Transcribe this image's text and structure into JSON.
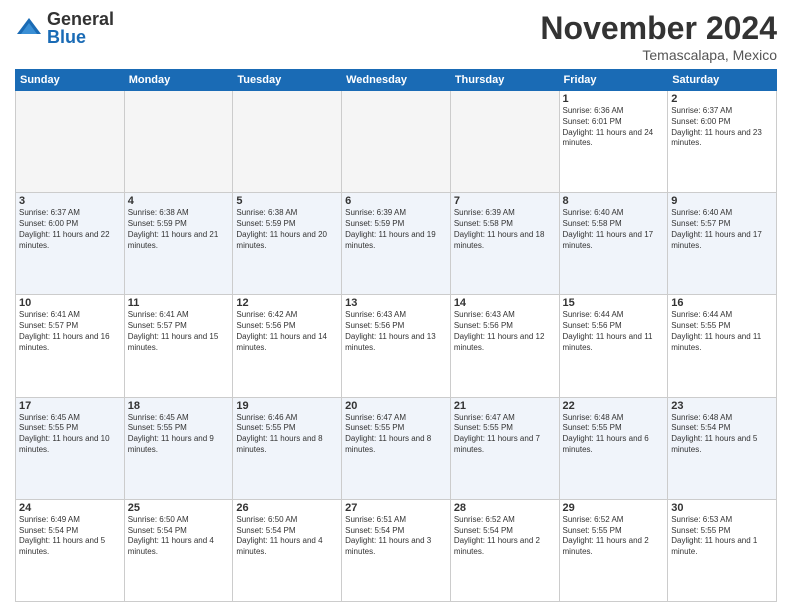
{
  "header": {
    "logo_general": "General",
    "logo_blue": "Blue",
    "month_title": "November 2024",
    "location": "Temascalapa, Mexico"
  },
  "columns": [
    "Sunday",
    "Monday",
    "Tuesday",
    "Wednesday",
    "Thursday",
    "Friday",
    "Saturday"
  ],
  "weeks": [
    [
      {
        "day": "",
        "info": ""
      },
      {
        "day": "",
        "info": ""
      },
      {
        "day": "",
        "info": ""
      },
      {
        "day": "",
        "info": ""
      },
      {
        "day": "",
        "info": ""
      },
      {
        "day": "1",
        "info": "Sunrise: 6:36 AM\nSunset: 6:01 PM\nDaylight: 11 hours and 24 minutes."
      },
      {
        "day": "2",
        "info": "Sunrise: 6:37 AM\nSunset: 6:00 PM\nDaylight: 11 hours and 23 minutes."
      }
    ],
    [
      {
        "day": "3",
        "info": "Sunrise: 6:37 AM\nSunset: 6:00 PM\nDaylight: 11 hours and 22 minutes."
      },
      {
        "day": "4",
        "info": "Sunrise: 6:38 AM\nSunset: 5:59 PM\nDaylight: 11 hours and 21 minutes."
      },
      {
        "day": "5",
        "info": "Sunrise: 6:38 AM\nSunset: 5:59 PM\nDaylight: 11 hours and 20 minutes."
      },
      {
        "day": "6",
        "info": "Sunrise: 6:39 AM\nSunset: 5:59 PM\nDaylight: 11 hours and 19 minutes."
      },
      {
        "day": "7",
        "info": "Sunrise: 6:39 AM\nSunset: 5:58 PM\nDaylight: 11 hours and 18 minutes."
      },
      {
        "day": "8",
        "info": "Sunrise: 6:40 AM\nSunset: 5:58 PM\nDaylight: 11 hours and 17 minutes."
      },
      {
        "day": "9",
        "info": "Sunrise: 6:40 AM\nSunset: 5:57 PM\nDaylight: 11 hours and 17 minutes."
      }
    ],
    [
      {
        "day": "10",
        "info": "Sunrise: 6:41 AM\nSunset: 5:57 PM\nDaylight: 11 hours and 16 minutes."
      },
      {
        "day": "11",
        "info": "Sunrise: 6:41 AM\nSunset: 5:57 PM\nDaylight: 11 hours and 15 minutes."
      },
      {
        "day": "12",
        "info": "Sunrise: 6:42 AM\nSunset: 5:56 PM\nDaylight: 11 hours and 14 minutes."
      },
      {
        "day": "13",
        "info": "Sunrise: 6:43 AM\nSunset: 5:56 PM\nDaylight: 11 hours and 13 minutes."
      },
      {
        "day": "14",
        "info": "Sunrise: 6:43 AM\nSunset: 5:56 PM\nDaylight: 11 hours and 12 minutes."
      },
      {
        "day": "15",
        "info": "Sunrise: 6:44 AM\nSunset: 5:56 PM\nDaylight: 11 hours and 11 minutes."
      },
      {
        "day": "16",
        "info": "Sunrise: 6:44 AM\nSunset: 5:55 PM\nDaylight: 11 hours and 11 minutes."
      }
    ],
    [
      {
        "day": "17",
        "info": "Sunrise: 6:45 AM\nSunset: 5:55 PM\nDaylight: 11 hours and 10 minutes."
      },
      {
        "day": "18",
        "info": "Sunrise: 6:45 AM\nSunset: 5:55 PM\nDaylight: 11 hours and 9 minutes."
      },
      {
        "day": "19",
        "info": "Sunrise: 6:46 AM\nSunset: 5:55 PM\nDaylight: 11 hours and 8 minutes."
      },
      {
        "day": "20",
        "info": "Sunrise: 6:47 AM\nSunset: 5:55 PM\nDaylight: 11 hours and 8 minutes."
      },
      {
        "day": "21",
        "info": "Sunrise: 6:47 AM\nSunset: 5:55 PM\nDaylight: 11 hours and 7 minutes."
      },
      {
        "day": "22",
        "info": "Sunrise: 6:48 AM\nSunset: 5:55 PM\nDaylight: 11 hours and 6 minutes."
      },
      {
        "day": "23",
        "info": "Sunrise: 6:48 AM\nSunset: 5:54 PM\nDaylight: 11 hours and 5 minutes."
      }
    ],
    [
      {
        "day": "24",
        "info": "Sunrise: 6:49 AM\nSunset: 5:54 PM\nDaylight: 11 hours and 5 minutes."
      },
      {
        "day": "25",
        "info": "Sunrise: 6:50 AM\nSunset: 5:54 PM\nDaylight: 11 hours and 4 minutes."
      },
      {
        "day": "26",
        "info": "Sunrise: 6:50 AM\nSunset: 5:54 PM\nDaylight: 11 hours and 4 minutes."
      },
      {
        "day": "27",
        "info": "Sunrise: 6:51 AM\nSunset: 5:54 PM\nDaylight: 11 hours and 3 minutes."
      },
      {
        "day": "28",
        "info": "Sunrise: 6:52 AM\nSunset: 5:54 PM\nDaylight: 11 hours and 2 minutes."
      },
      {
        "day": "29",
        "info": "Sunrise: 6:52 AM\nSunset: 5:55 PM\nDaylight: 11 hours and 2 minutes."
      },
      {
        "day": "30",
        "info": "Sunrise: 6:53 AM\nSunset: 5:55 PM\nDaylight: 11 hours and 1 minute."
      }
    ]
  ]
}
